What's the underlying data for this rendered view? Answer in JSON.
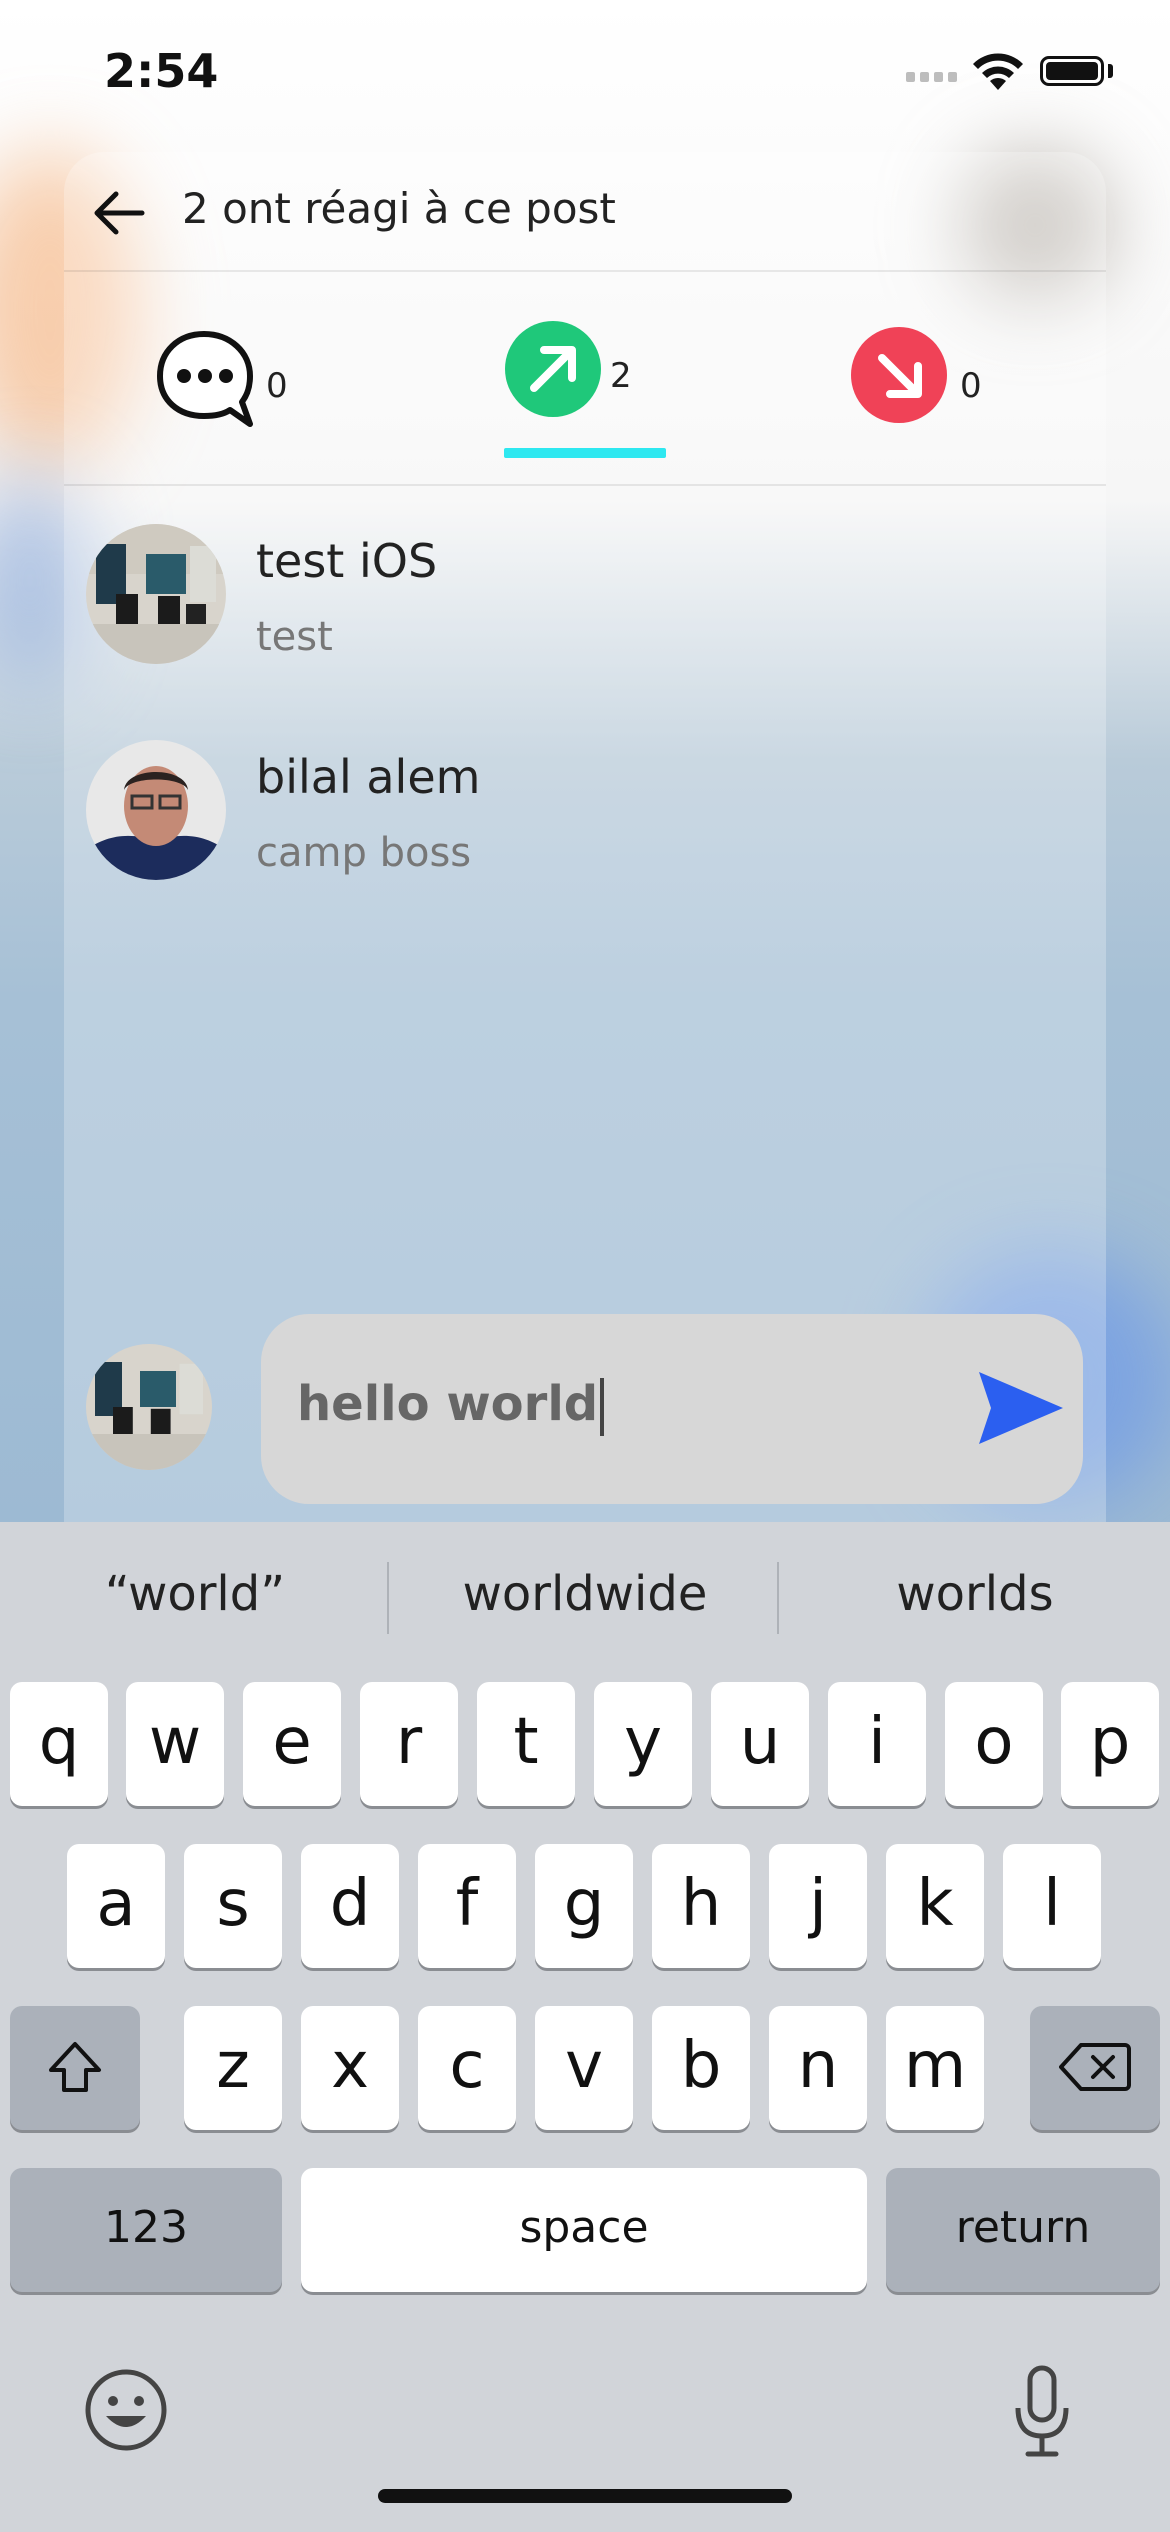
{
  "status_bar": {
    "time": "2:54"
  },
  "header": {
    "title": "2 ont réagi à ce post"
  },
  "tabs": [
    {
      "icon": "comment-icon",
      "count": "0",
      "selected": false
    },
    {
      "icon": "arrow-up-right-icon",
      "count": "2",
      "selected": true,
      "color": "#1fc87a"
    },
    {
      "icon": "arrow-down-right-icon",
      "count": "0",
      "selected": false,
      "color": "#f04257"
    }
  ],
  "reactions": [
    {
      "name": "test iOS",
      "subtitle": "test"
    },
    {
      "name": "bilal alem",
      "subtitle": "camp boss"
    }
  ],
  "composer": {
    "value": "hello world"
  },
  "keyboard": {
    "suggestions": [
      "“world”",
      "worldwide",
      "worlds"
    ],
    "row1": [
      "q",
      "w",
      "e",
      "r",
      "t",
      "y",
      "u",
      "i",
      "o",
      "p"
    ],
    "row2": [
      "a",
      "s",
      "d",
      "f",
      "g",
      "h",
      "j",
      "k",
      "l"
    ],
    "row3": [
      "z",
      "x",
      "c",
      "v",
      "b",
      "n",
      "m"
    ],
    "numbers_label": "123",
    "space_label": "space",
    "return_label": "return"
  },
  "colors": {
    "send_accent": "#2b5ff0",
    "tab_underline": "#2ee8f0"
  }
}
